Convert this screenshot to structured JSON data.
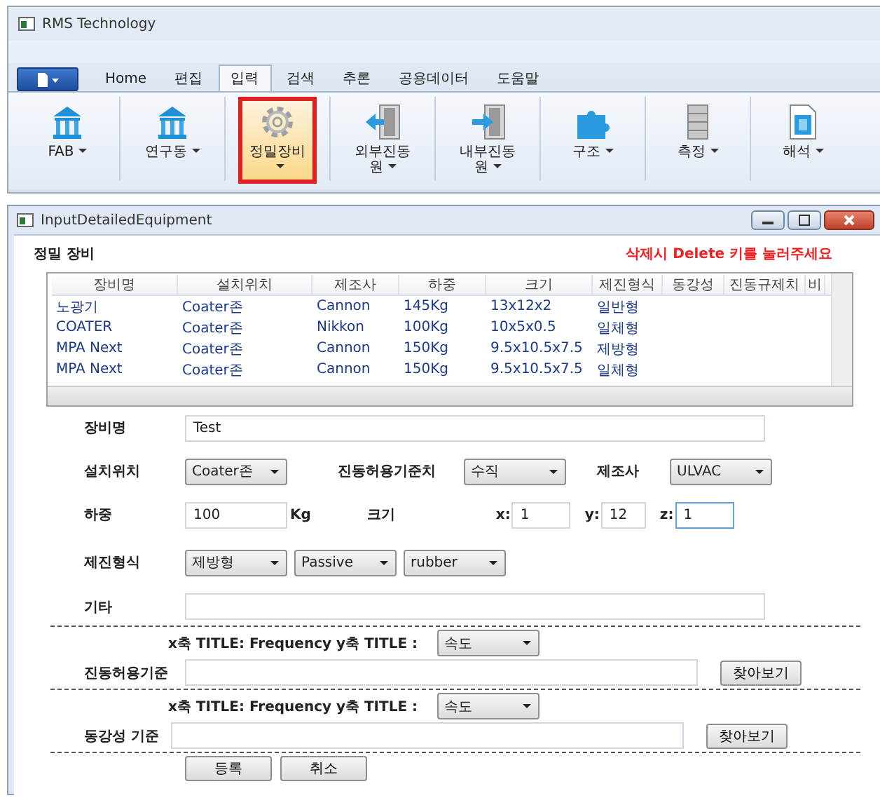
{
  "window": {
    "title": "RMS Technology"
  },
  "ribbon": {
    "tabs": [
      {
        "label": "Home",
        "selected": false
      },
      {
        "label": "편집",
        "selected": false
      },
      {
        "label": "입력",
        "selected": true
      },
      {
        "label": "검색",
        "selected": false
      },
      {
        "label": "추론",
        "selected": false
      },
      {
        "label": "공용데이터",
        "selected": false
      },
      {
        "label": "도움말",
        "selected": false
      }
    ],
    "buttons": [
      {
        "label": "FAB",
        "kind": "building",
        "selected": false
      },
      {
        "label": "연구동",
        "kind": "building",
        "selected": false
      },
      {
        "label": "정밀장비",
        "kind": "gear",
        "selected": true
      },
      {
        "label": "외부진동원",
        "kind": "door-in",
        "selected": false
      },
      {
        "label": "내부진동원",
        "kind": "door-out",
        "selected": false
      },
      {
        "label": "구조",
        "kind": "puzzle",
        "selected": false
      },
      {
        "label": "측정",
        "kind": "stack",
        "selected": false
      },
      {
        "label": "해석",
        "kind": "document",
        "selected": false
      }
    ]
  },
  "dialog": {
    "title": "InputDetailedEquipment",
    "heading": "정밀 장비",
    "hint": "삭제시 Delete 키를 눌러주세요",
    "table": {
      "columns": [
        "장비명",
        "설치위치",
        "제조사",
        "하중",
        "크기",
        "제진형식",
        "동강성",
        "진동규제치",
        "비"
      ],
      "rows": [
        [
          "노광기",
          "Coater존",
          "Cannon",
          "145Kg",
          "13x12x2",
          "일반형"
        ],
        [
          "COATER",
          "Coater존",
          "Nikkon",
          "100Kg",
          "10x5x0.5",
          "일체형"
        ],
        [
          "MPA Next",
          "Coater존",
          "Cannon",
          "150Kg",
          "9.5x10.5x7.5",
          "제방형"
        ],
        [
          "MPA Next",
          "Coater존",
          "Cannon",
          "150Kg",
          "9.5x10.5x7.5",
          "일체형"
        ]
      ]
    },
    "form": {
      "name": {
        "label": "장비명",
        "value": "Test"
      },
      "location": {
        "label": "설치위치",
        "value": "Coater존"
      },
      "vibration_axis": {
        "label": "진동허용기준치",
        "value": "수직"
      },
      "maker": {
        "label": "제조사",
        "value": "ULVAC"
      },
      "load": {
        "label": "하중",
        "value": "100",
        "unit": "Kg"
      },
      "size": {
        "label": "크기",
        "dims": [
          {
            "label": "x:",
            "value": "1",
            "focused": false
          },
          {
            "label": "y:",
            "value": "12",
            "focused": false
          },
          {
            "label": "z:",
            "value": "1",
            "focused": true
          }
        ]
      },
      "isolation": {
        "label": "제진형식",
        "values": [
          "제방형",
          "Passive",
          "rubber"
        ]
      },
      "other": {
        "label": "기타"
      },
      "criteria": [
        {
          "axis_text": "x축 TITLE: Frequency y축 TITLE :",
          "y_value": "속도",
          "label": "진동허용기준",
          "browse": "찾아보기"
        },
        {
          "axis_text": "x축 TITLE: Frequency y축 TITLE :",
          "y_value": "속도",
          "label": "동강성 기준",
          "browse": "찾아보기"
        }
      ],
      "actions": [
        "등록",
        "취소"
      ]
    }
  }
}
